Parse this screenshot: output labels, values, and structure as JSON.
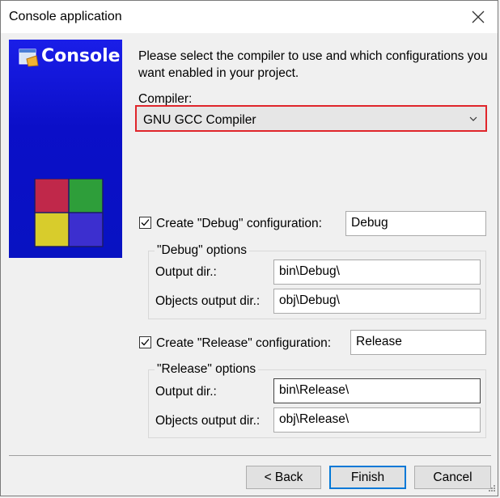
{
  "window": {
    "title": "Console application"
  },
  "banner": {
    "title": "Console"
  },
  "intro": "Please select the compiler to use and which configurations you want enabled in your project.",
  "compiler": {
    "label": "Compiler:",
    "value": "GNU GCC Compiler"
  },
  "debug": {
    "checkbox_label": "Create \"Debug\" configuration:",
    "checked": true,
    "name": "Debug",
    "group_title": "\"Debug\" options",
    "output_label": "Output dir.:",
    "output_value": "bin\\Debug\\",
    "objects_label": "Objects output dir.:",
    "objects_value": "obj\\Debug\\"
  },
  "release": {
    "checkbox_label": "Create \"Release\" configuration:",
    "checked": true,
    "name": "Release",
    "group_title": "\"Release\" options",
    "output_label": "Output dir.:",
    "output_value": "bin\\Release\\",
    "objects_label": "Objects output dir.:",
    "objects_value": "obj\\Release\\"
  },
  "buttons": {
    "back": "< Back",
    "finish": "Finish",
    "cancel": "Cancel"
  },
  "colors": {
    "banner": "#0b0fc8",
    "highlight": "#e0252b",
    "default_button": "#0078d7"
  },
  "icons": [
    "close-icon",
    "console-app-icon",
    "chevron-down-icon",
    "checkmark-icon"
  ]
}
